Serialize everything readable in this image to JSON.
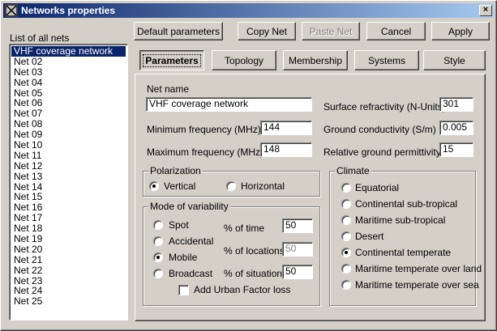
{
  "window": {
    "title": "Networks properties",
    "close_glyph": "×"
  },
  "net_list": {
    "label": "List of all nets",
    "items": [
      "VHF coverage network",
      "Net 02",
      "Net 03",
      "Net 04",
      "Net 05",
      "Net 06",
      "Net 07",
      "Net 08",
      "Net 09",
      "Net 10",
      "Net 11",
      "Net 12",
      "Net 13",
      "Net 14",
      "Net 15",
      "Net 16",
      "Net 17",
      "Net 18",
      "Net 19",
      "Net 20",
      "Net 21",
      "Net 22",
      "Net 23",
      "Net 24",
      "Net 25"
    ],
    "selected_index": 0
  },
  "toolbar": {
    "default_params": "Default parameters",
    "copy_net": "Copy Net",
    "paste_net": "Paste Net",
    "cancel": "Cancel",
    "apply": "Apply"
  },
  "tabs": [
    "Parameters",
    "Topology",
    "Membership",
    "Systems",
    "Style"
  ],
  "parameters": {
    "net_name_label": "Net name",
    "net_name_value": "VHF coverage network",
    "min_freq_label": "Minimum frequency (MHz)",
    "min_freq_value": "144",
    "max_freq_label": "Maximum frequency (MHz)",
    "max_freq_value": "148",
    "surface_refr_label": "Surface refractivity (N-Units)",
    "surface_refr_value": "301",
    "ground_cond_label": "Ground conductivity (S/m)",
    "ground_cond_value": "0.005",
    "rel_perm_label": "Relative ground permittivity",
    "rel_perm_value": "15"
  },
  "polarization": {
    "legend": "Polarization",
    "options": [
      "Vertical",
      "Horizontal"
    ],
    "selected": "Vertical"
  },
  "variability": {
    "legend": "Mode of variability",
    "modes": [
      "Spot",
      "Accidental",
      "Mobile",
      "Broadcast"
    ],
    "selected": "Mobile",
    "time_label": "% of time",
    "time_value": "50",
    "locations_label": "% of locations",
    "locations_value": "50",
    "situations_label": "% of situations",
    "situations_value": "50",
    "urban_loss_label": "Add Urban Factor loss",
    "urban_loss_checked": false
  },
  "climate": {
    "legend": "Climate",
    "options": [
      "Equatorial",
      "Continental sub-tropical",
      "Maritime sub-tropical",
      "Desert",
      "Continental temperate",
      "Maritime temperate over land",
      "Maritime temperate over sea"
    ],
    "selected": "Continental temperate"
  }
}
